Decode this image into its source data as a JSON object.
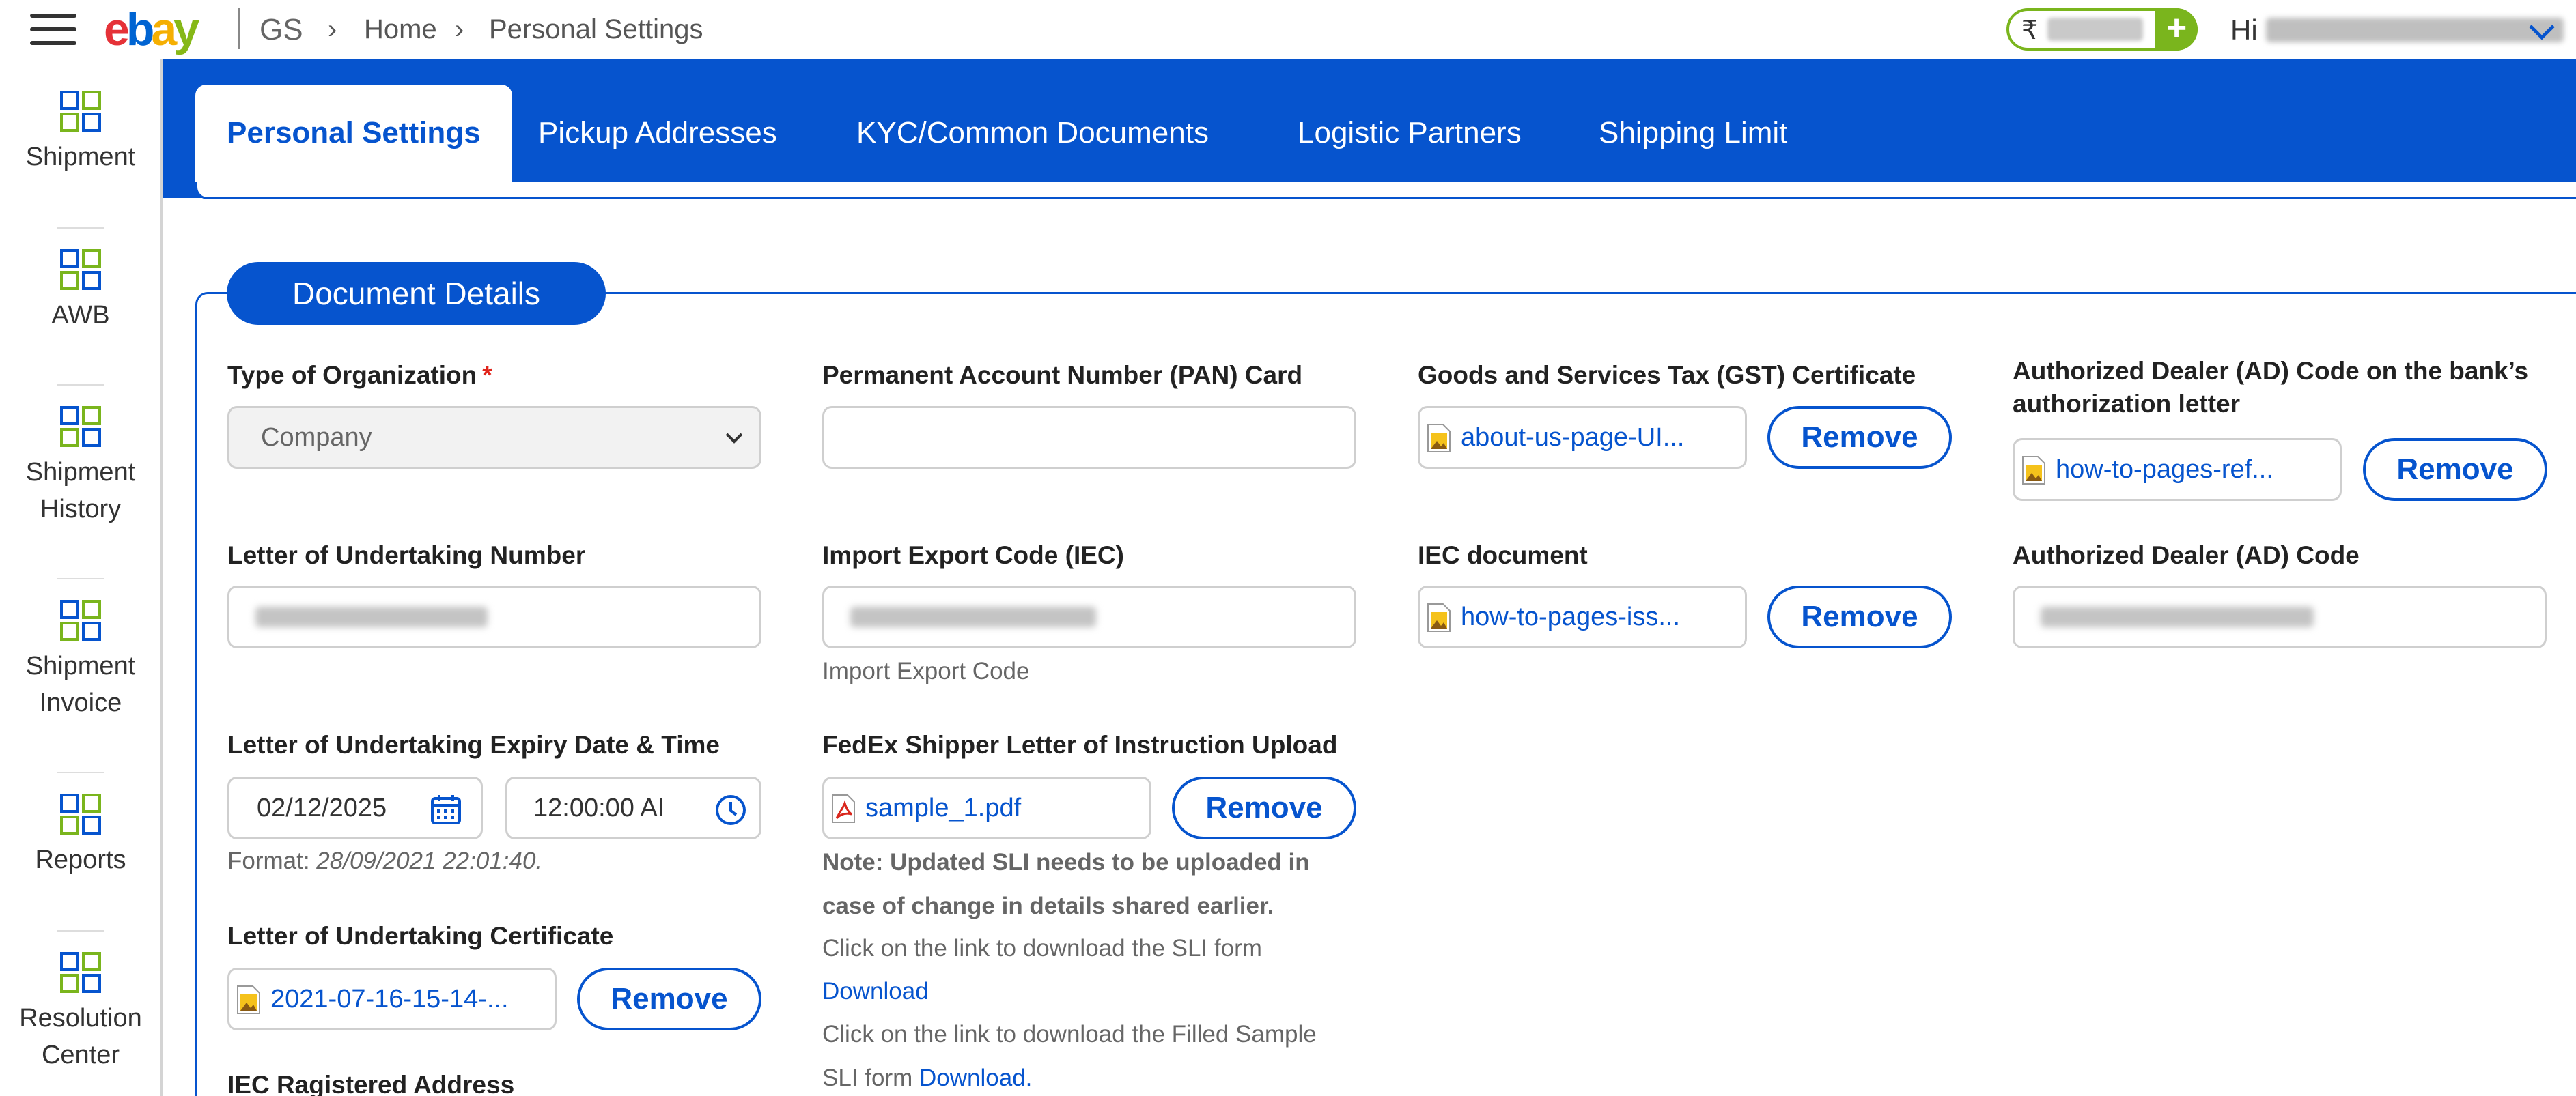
{
  "header": {
    "logo": [
      "e",
      "b",
      "a",
      "y"
    ],
    "section": "GS",
    "breadcrumb": [
      "Home",
      "Personal Settings"
    ],
    "wallet_currency": "₹",
    "greeting": "Hi"
  },
  "sidebar": {
    "items": [
      {
        "label_lines": [
          "Shipment"
        ]
      },
      {
        "label_lines": [
          "AWB"
        ]
      },
      {
        "label_lines": [
          "Shipment",
          "History"
        ]
      },
      {
        "label_lines": [
          "Shipment",
          "Invoice"
        ]
      },
      {
        "label_lines": [
          "Reports"
        ]
      },
      {
        "label_lines": [
          "Resolution",
          "Center"
        ]
      }
    ]
  },
  "tabs": [
    "Personal Settings",
    "Pickup Addresses",
    "KYC/Common Documents",
    "Logistic Partners",
    "Shipping Limit"
  ],
  "active_tab": "Personal Settings",
  "panel": {
    "title": "Document Details",
    "remove_label": "Remove",
    "org_type": {
      "label": "Type of Organization",
      "required": "*",
      "value": "Company"
    },
    "pan": {
      "label": "Permanent Account Number (PAN) Card",
      "value": ""
    },
    "gst": {
      "label": "Goods and Services Tax (GST) Certificate",
      "file": "about-us-page-UI..."
    },
    "ad_letter": {
      "label_lines": [
        "Authorized Dealer (AD) Code on the bank’s",
        "authorization letter"
      ],
      "file": "how-to-pages-ref..."
    },
    "lut_number": {
      "label": "Letter of Undertaking Number"
    },
    "iec": {
      "label": "Import Export Code (IEC)",
      "hint": "Import Export Code"
    },
    "iec_doc": {
      "label": "IEC document",
      "file": "how-to-pages-iss..."
    },
    "ad_code": {
      "label": "Authorized Dealer (AD) Code"
    },
    "lut_expiry": {
      "label": "Letter of Undertaking Expiry Date & Time",
      "date": "02/12/2025",
      "time": "12:00:00 AI",
      "format_prefix": "Format: ",
      "format_example": "28/09/2021 22:01:40."
    },
    "sli": {
      "label": "FedEx Shipper Letter of Instruction Upload",
      "file": "sample_1.pdf",
      "note_lines": [
        "Note: Updated SLI needs to be uploaded in",
        "case of change in details shared earlier."
      ],
      "download_text": "Click on the link to download the SLI form",
      "download_link": "Download",
      "sample_text_lines": [
        "Click on the link to download the Filled Sample",
        "SLI form "
      ],
      "sample_link": "Download."
    },
    "lut_cert": {
      "label": "Letter of Undertaking Certificate",
      "file": "2021-07-16-15-14-..."
    },
    "iec_address": {
      "label": "IEC Ragistered Address"
    }
  },
  "colors": {
    "primary": "#0654ce",
    "wallet_green": "#7ab51d",
    "required_red": "#e0241b"
  }
}
